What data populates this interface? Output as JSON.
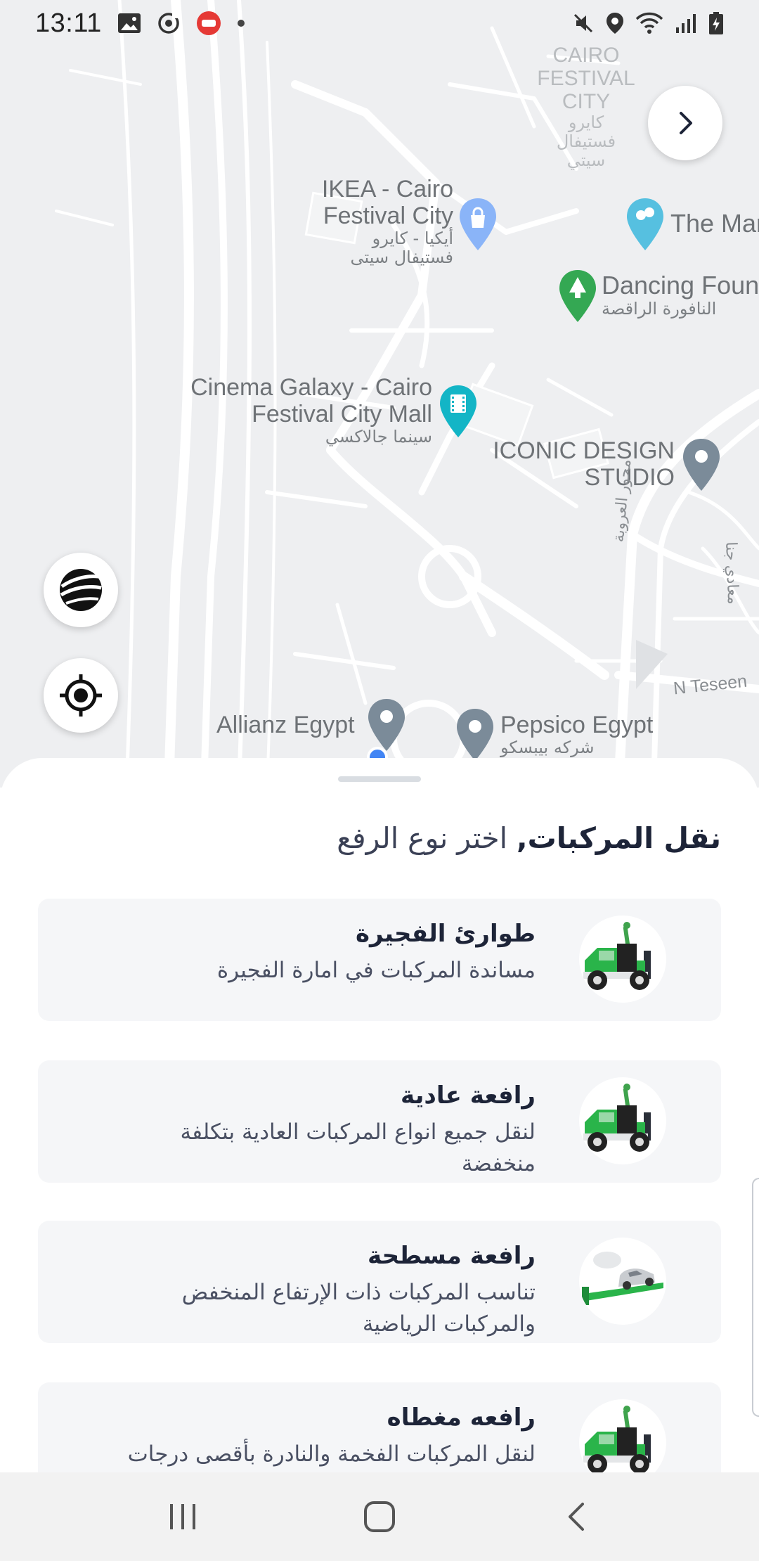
{
  "status_bar": {
    "time": "13:11",
    "left_icons": [
      "gallery-icon",
      "sync-icon",
      "app-notification-icon",
      "dot-icon"
    ],
    "right_icons": [
      "mute-icon",
      "location-icon",
      "wifi-icon",
      "signal-icon",
      "battery-icon"
    ]
  },
  "map": {
    "labels": {
      "cairo_festival_city_en": "CAIRO FESTIVAL CITY",
      "cairo_festival_city_ar": "كايرو فستيفال سيتي",
      "ikea_en_1": "IKEA - Cairo",
      "ikea_en_2": "Festival City",
      "ikea_ar_1": "أيكيا - كايرو",
      "ikea_ar_2": "فستيفال سيتى",
      "the_mar": "The Mar",
      "dancing_en": "Dancing Fount",
      "dancing_ar": "النافورة الراقصة",
      "cinema_en_1": "Cinema Galaxy - Cairo",
      "cinema_en_2": "Festival City Mall",
      "cinema_ar": "سينما جالاكسي",
      "iconic_1": "ICONIC DESIGN",
      "iconic_2": "STUDIO",
      "mehwar": "محور العروبة",
      "maadi": "معادي جنا",
      "n_teseen": "N Teseen",
      "allianz": "Allianz Egypt",
      "pepsico_en": "Pepsico Egypt",
      "pepsico_ar": "شركه بيبسكو"
    }
  },
  "controls": {
    "forward_icon": "chevron-right-icon",
    "globe_icon": "globe-icon",
    "my_location_icon": "my-location-icon"
  },
  "sheet": {
    "title_strong": "نقل المركبات,",
    "title_light": " اختر نوع الرفع",
    "options": [
      {
        "title": "طوارئ الفجيرة",
        "subtitle": "مساندة المركبات في امارة الفجيرة",
        "icon": "tow-truck-icon"
      },
      {
        "title": "رافعة عادية",
        "subtitle": "لنقل جميع انواع المركبات العادية بتكلفة منخفضة",
        "icon": "tow-truck-icon"
      },
      {
        "title": "رافعة مسطحة",
        "subtitle": "تناسب المركبات ذات الإرتفاع المنخفض والمركبات الرياضية",
        "icon": "flatbed-truck-icon"
      },
      {
        "title": "رافعه مغطاه",
        "subtitle": "لنقل المركبات الفخمة والنادرة بأقصى درجات",
        "icon": "tow-truck-icon"
      }
    ]
  },
  "nav": {
    "recent": "recent-apps-icon",
    "home": "home-icon",
    "back": "back-icon"
  }
}
